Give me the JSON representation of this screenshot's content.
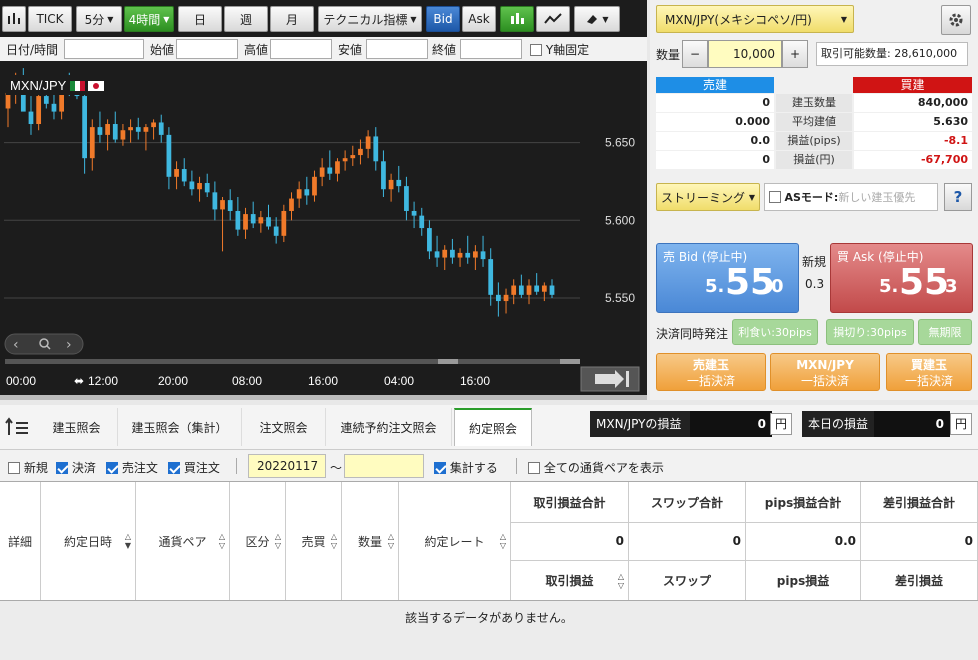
{
  "toolbar": {
    "tick": "TICK",
    "interval": "5分",
    "period": "4時間",
    "day": "日",
    "week": "週",
    "month": "月",
    "technical": "テクニカル指標",
    "bid": "Bid",
    "ask": "Ask"
  },
  "fields": {
    "datetime": "日付/時間",
    "open": "始値",
    "high": "高値",
    "low": "安値",
    "close": "終値",
    "yaxis_lock": "Y軸固定"
  },
  "chart_data": {
    "type": "candlestick",
    "title": "MXN/JPY",
    "ylim": [
      5.53,
      5.7
    ],
    "y_ticks": [
      5.65,
      5.6,
      5.55
    ],
    "x_tick_labels": [
      "00:00",
      "12:00",
      "20:00",
      "08:00",
      "16:00",
      "04:00",
      "16:00"
    ],
    "candles": [
      [
        5.672,
        5.69,
        5.66,
        5.682
      ],
      [
        5.682,
        5.695,
        5.675,
        5.688
      ],
      [
        5.688,
        5.698,
        5.68,
        5.67
      ],
      [
        5.67,
        5.68,
        5.655,
        5.662
      ],
      [
        5.662,
        5.685,
        5.658,
        5.68
      ],
      [
        5.68,
        5.69,
        5.672,
        5.675
      ],
      [
        5.675,
        5.682,
        5.665,
        5.67
      ],
      [
        5.67,
        5.69,
        5.665,
        5.688
      ],
      [
        5.688,
        5.695,
        5.68,
        5.686
      ],
      [
        5.686,
        5.69,
        5.678,
        5.68
      ],
      [
        5.68,
        5.685,
        5.63,
        5.64
      ],
      [
        5.64,
        5.665,
        5.632,
        5.66
      ],
      [
        5.66,
        5.67,
        5.65,
        5.655
      ],
      [
        5.655,
        5.665,
        5.645,
        5.662
      ],
      [
        5.662,
        5.67,
        5.65,
        5.652
      ],
      [
        5.652,
        5.662,
        5.648,
        5.658
      ],
      [
        5.658,
        5.665,
        5.65,
        5.66
      ],
      [
        5.66,
        5.666,
        5.652,
        5.657
      ],
      [
        5.657,
        5.662,
        5.645,
        5.66
      ],
      [
        5.66,
        5.665,
        5.652,
        5.663
      ],
      [
        5.663,
        5.668,
        5.65,
        5.655
      ],
      [
        5.655,
        5.66,
        5.62,
        5.628
      ],
      [
        5.628,
        5.638,
        5.62,
        5.633
      ],
      [
        5.633,
        5.64,
        5.622,
        5.625
      ],
      [
        5.625,
        5.632,
        5.616,
        5.62
      ],
      [
        5.62,
        5.628,
        5.612,
        5.624
      ],
      [
        5.624,
        5.63,
        5.615,
        5.618
      ],
      [
        5.618,
        5.625,
        5.6,
        5.607
      ],
      [
        5.607,
        5.615,
        5.58,
        5.613
      ],
      [
        5.613,
        5.62,
        5.6,
        5.606
      ],
      [
        5.606,
        5.615,
        5.59,
        5.594
      ],
      [
        5.594,
        5.608,
        5.588,
        5.604
      ],
      [
        5.604,
        5.612,
        5.595,
        5.598
      ],
      [
        5.598,
        5.606,
        5.592,
        5.602
      ],
      [
        5.602,
        5.61,
        5.594,
        5.596
      ],
      [
        5.596,
        5.602,
        5.585,
        5.59
      ],
      [
        5.59,
        5.61,
        5.586,
        5.606
      ],
      [
        5.606,
        5.618,
        5.6,
        5.614
      ],
      [
        5.614,
        5.625,
        5.608,
        5.62
      ],
      [
        5.62,
        5.628,
        5.61,
        5.616
      ],
      [
        5.616,
        5.632,
        5.612,
        5.628
      ],
      [
        5.628,
        5.64,
        5.622,
        5.634
      ],
      [
        5.634,
        5.645,
        5.626,
        5.63
      ],
      [
        5.63,
        5.64,
        5.625,
        5.638
      ],
      [
        5.638,
        5.645,
        5.632,
        5.64
      ],
      [
        5.64,
        5.648,
        5.635,
        5.642
      ],
      [
        5.642,
        5.652,
        5.636,
        5.646
      ],
      [
        5.646,
        5.658,
        5.64,
        5.654
      ],
      [
        5.654,
        5.66,
        5.632,
        5.638
      ],
      [
        5.638,
        5.645,
        5.615,
        5.62
      ],
      [
        5.62,
        5.63,
        5.612,
        5.626
      ],
      [
        5.626,
        5.635,
        5.618,
        5.622
      ],
      [
        5.622,
        5.628,
        5.6,
        5.606
      ],
      [
        5.606,
        5.612,
        5.595,
        5.603
      ],
      [
        5.603,
        5.608,
        5.59,
        5.595
      ],
      [
        5.595,
        5.6,
        5.575,
        5.58
      ],
      [
        5.58,
        5.59,
        5.57,
        5.576
      ],
      [
        5.576,
        5.584,
        5.568,
        5.581
      ],
      [
        5.581,
        5.588,
        5.572,
        5.576
      ],
      [
        5.576,
        5.582,
        5.57,
        5.579
      ],
      [
        5.579,
        5.59,
        5.572,
        5.576
      ],
      [
        5.576,
        5.584,
        5.568,
        5.58
      ],
      [
        5.58,
        5.59,
        5.57,
        5.575
      ],
      [
        5.575,
        5.582,
        5.545,
        5.552
      ],
      [
        5.552,
        5.56,
        5.538,
        5.548
      ],
      [
        5.548,
        5.556,
        5.54,
        5.552
      ],
      [
        5.552,
        5.562,
        5.546,
        5.558
      ],
      [
        5.558,
        5.565,
        5.55,
        5.552
      ],
      [
        5.552,
        5.562,
        5.546,
        5.558
      ],
      [
        5.558,
        5.566,
        5.552,
        5.554
      ],
      [
        5.554,
        5.56,
        5.548,
        5.558
      ],
      [
        5.558,
        5.562,
        5.55,
        5.552
      ]
    ]
  },
  "trade": {
    "pair": "MXN/JPY(メキシコペソ/円)",
    "qty_label": "数量",
    "qty_minus": "−",
    "qty_value": "10,000",
    "qty_plus": "+",
    "available": "取引可能数量: 28,610,000",
    "sell_header": "売建",
    "buy_header": "買建",
    "rows": [
      {
        "label": "建玉数量",
        "sell": "0",
        "buy": "840,000"
      },
      {
        "label": "平均建値",
        "sell": "0.000",
        "buy": "5.630"
      },
      {
        "label": "損益(pips)",
        "sell": "0.0",
        "buy": "-8.1"
      },
      {
        "label": "損益(円)",
        "sell": "0",
        "buy": "-67,700"
      }
    ],
    "streaming": "ストリーミング",
    "as_mode": "ASモード:",
    "as_mode_placeholder": "新しい建玉優先",
    "help": "?",
    "sell_title": "売 Bid (停止中)",
    "sell_small": "5.",
    "sell_big": "55",
    "sell_last": "0",
    "new_label": "新規",
    "spread": "0.3",
    "buy_title": "買 Ask (停止中)",
    "buy_small": "5.",
    "buy_big": "55",
    "buy_last": "3",
    "settle_label": "決済同時発注",
    "take_profit": "利食い:30pips",
    "stop_loss": "損切り:30pips",
    "unlimited": "無期限",
    "close_sell_1": "売建玉",
    "close_sell_2": "一括決済",
    "close_pair_1": "MXN/JPY",
    "close_pair_2": "一括決済",
    "close_buy_1": "買建玉",
    "close_buy_2": "一括決済"
  },
  "bottom": {
    "tabs": [
      "建玉照会",
      "建玉照会（集計）",
      "注文照会",
      "連続予約注文照会",
      "約定照会"
    ],
    "pair_pl_label": "MXN/JPYの損益",
    "pair_pl_value": "0",
    "today_pl_label": "本日の損益",
    "today_pl_value": "0",
    "unit": "円",
    "filters": {
      "new": "新規",
      "settle": "決済",
      "sell": "売注文",
      "buy": "買注文",
      "date_from": "20220117",
      "tilde": "〜",
      "date_to": "",
      "aggregate": "集計する",
      "all_pairs": "全ての通貨ペアを表示"
    },
    "columns": [
      "詳細",
      "約定日時",
      "通貨ペア",
      "区分",
      "売買",
      "数量",
      "約定レート"
    ],
    "sum_headers": [
      "取引損益合計",
      "スワップ合計",
      "pips損益合計",
      "差引損益合計"
    ],
    "sum_values": [
      "0",
      "0",
      "0.0",
      "0"
    ],
    "sub_headers": [
      "取引損益",
      "スワップ",
      "pips損益",
      "差引損益"
    ],
    "no_data": "該当するデータがありません。"
  },
  "colors": {
    "up": "#f07a2a",
    "down": "#3fb8e0",
    "sell": "#1e8ee6",
    "buy": "#d01414"
  }
}
